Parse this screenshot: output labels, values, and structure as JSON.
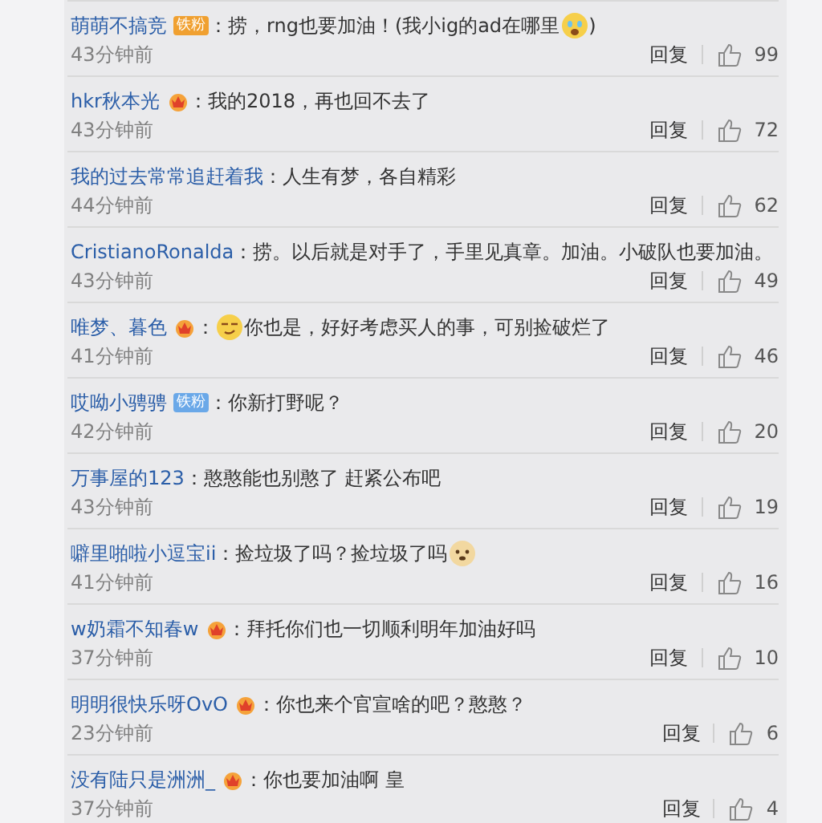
{
  "comments": [
    {
      "user": "萌萌不搞竞",
      "badge": {
        "kind": "fan",
        "label": "铁粉",
        "color": "#f0a030"
      },
      "parts": [
        {
          "text": "：捞，rng也要加油！(我小ig的ad在哪里"
        },
        {
          "kind": "cry"
        },
        {
          "text": ")"
        }
      ],
      "time": "43分钟前",
      "reply": "回复",
      "likes": "99"
    },
    {
      "user": "hkr秋本光",
      "badge": {
        "kind": "vip"
      },
      "parts": [
        {
          "text": "：我的2018，再也回不去了"
        }
      ],
      "time": "43分钟前",
      "reply": "回复",
      "likes": "72"
    },
    {
      "user": "我的过去常常追赶着我",
      "parts": [
        {
          "text": "：人生有梦，各自精彩"
        }
      ],
      "time": "44分钟前",
      "reply": "回复",
      "likes": "62"
    },
    {
      "user": "CristianoRonalda",
      "parts": [
        {
          "text": "：捞。以后就是对手了，手里见真章。加油。小破队也要加油。"
        }
      ],
      "time": "43分钟前",
      "reply": "回复",
      "likes": "49"
    },
    {
      "user": "唯梦、暮色",
      "badge": {
        "kind": "vip"
      },
      "parts": [
        {
          "text": "："
        },
        {
          "kind": "smirk"
        },
        {
          "text": "你也是，好好考虑买人的事，可别捡破烂了"
        }
      ],
      "time": "41分钟前",
      "reply": "回复",
      "likes": "46"
    },
    {
      "user": "哎呦小骋骋",
      "badge": {
        "kind": "fan",
        "label": "铁粉",
        "color": "#6aa8e8"
      },
      "parts": [
        {
          "text": "：你新打野呢？"
        }
      ],
      "time": "42分钟前",
      "reply": "回复",
      "likes": "20"
    },
    {
      "user": "万事屋的123",
      "parts": [
        {
          "text": "：憨憨能也别憨了 赶紧公布吧"
        }
      ],
      "time": "43分钟前",
      "reply": "回复",
      "likes": "19"
    },
    {
      "user": "噼里啪啦小逗宝ii",
      "parts": [
        {
          "text": "：捡垃圾了吗？捡垃圾了吗"
        },
        {
          "kind": "doge"
        }
      ],
      "time": "41分钟前",
      "reply": "回复",
      "likes": "16"
    },
    {
      "user": "w奶霜不知春w",
      "badge": {
        "kind": "vip"
      },
      "parts": [
        {
          "text": "：拜托你们也一切顺利明年加油好吗"
        }
      ],
      "time": "37分钟前",
      "reply": "回复",
      "likes": "10"
    },
    {
      "user": "明明很快乐呀OvO",
      "badge": {
        "kind": "vip"
      },
      "parts": [
        {
          "text": "：你也来个官宣啥的吧？憨憨？"
        }
      ],
      "time": "23分钟前",
      "reply": "回复",
      "likes": "6"
    },
    {
      "user": "没有陆只是洲洲_",
      "badge": {
        "kind": "vip"
      },
      "parts": [
        {
          "text": "：你也要加油啊 皇"
        }
      ],
      "time": "37分钟前",
      "reply": "回复",
      "likes": "4"
    }
  ]
}
